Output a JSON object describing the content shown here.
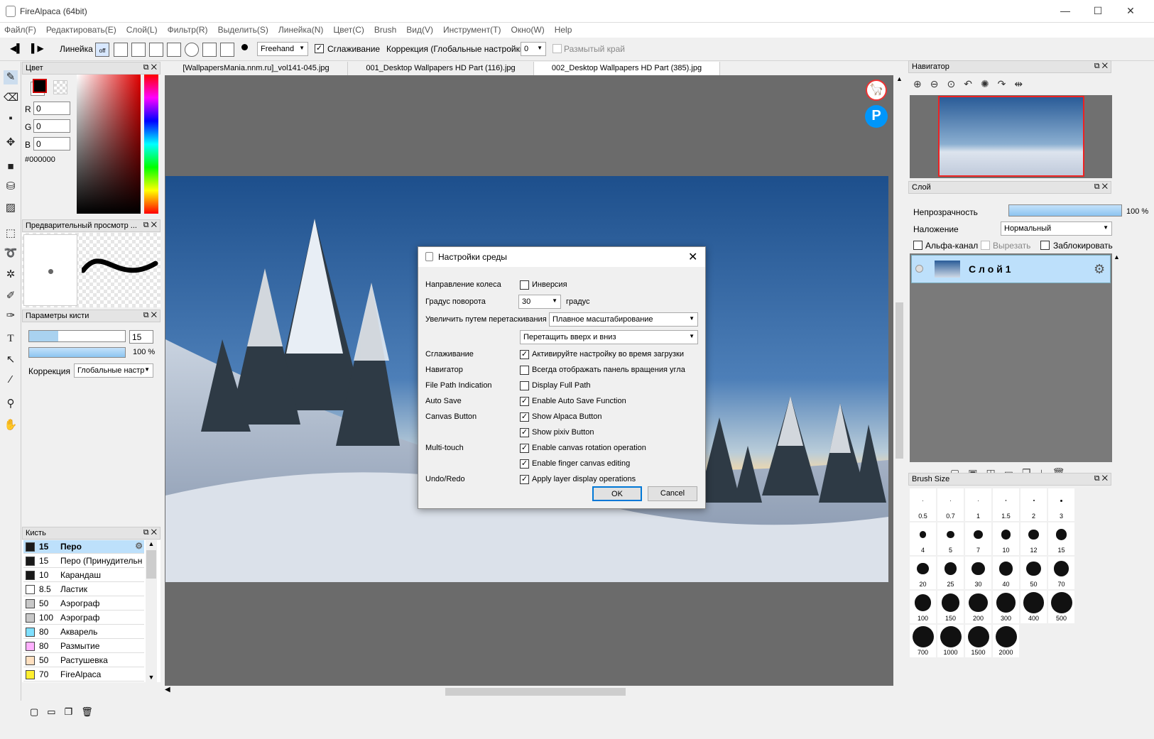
{
  "window": {
    "title": "FireAlpaca (64bit)"
  },
  "menu": [
    "Файл(F)",
    "Редактировать(E)",
    "Слой(L)",
    "Фильтр(R)",
    "Выделить(S)",
    "Линейка(N)",
    "Цвет(C)",
    "Brush",
    "Вид(V)",
    "Инструмент(T)",
    "Окно(W)",
    "Help"
  ],
  "toolbar": {
    "ruler_label": "Линейка",
    "off_label": "off",
    "mode": "Freehand",
    "smoothing_label": "Сглаживание",
    "correction_label": "Коррекция (Глобальные настройки)",
    "correction_value": "0",
    "blur_edge_label": "Размытый край"
  },
  "color_panel": {
    "title": "Цвет",
    "r_label": "R",
    "g_label": "G",
    "b_label": "B",
    "r": "0",
    "g": "0",
    "b": "0",
    "hex": "#000000",
    "fg": "#000000",
    "bg": "#ffffff"
  },
  "preview_panel": {
    "title": "Предварительный просмотр ..."
  },
  "brush_params": {
    "title": "Параметры кисти",
    "size": "15",
    "opacity": "100 %",
    "correction_label": "Коррекция",
    "correction_value": "Глобальные настр"
  },
  "brush_panel": {
    "title": "Кисть",
    "items": [
      {
        "size": "15",
        "name": "Перо",
        "color": "#1a1a1a"
      },
      {
        "size": "15",
        "name": "Перо (Принудительн",
        "color": "#1a1a1a"
      },
      {
        "size": "10",
        "name": "Карандаш",
        "color": "#1a1a1a"
      },
      {
        "size": "8.5",
        "name": "Ластик",
        "color": "#ffffff"
      },
      {
        "size": "50",
        "name": "Аэрограф",
        "color": "#c8c8c8"
      },
      {
        "size": "100",
        "name": "Аэрограф",
        "color": "#c8c8c8"
      },
      {
        "size": "80",
        "name": "Акварель",
        "color": "#7fe0ff"
      },
      {
        "size": "80",
        "name": "Размытие",
        "color": "#ffb0ff"
      },
      {
        "size": "50",
        "name": "Растушевка",
        "color": "#ffe0c0"
      },
      {
        "size": "70",
        "name": "FireAlpaca",
        "color": "#ffef30"
      }
    ]
  },
  "tabs": [
    "[WallpapersMania.nnm.ru]_vol141-045.jpg",
    "001_Desktop Wallpapers  HD Part (116).jpg",
    "002_Desktop Wallpapers  HD Part (385).jpg"
  ],
  "dialog": {
    "title": "Настройки среды",
    "rows": [
      {
        "label": "Направление колеса",
        "check": "Инверсия",
        "checked": false
      },
      {
        "label": "Градус поворота",
        "select": "30",
        "suffix": "градус"
      },
      {
        "label": "Увеличить путем перетаскивания",
        "select": "Плавное масштабирование"
      },
      {
        "label": "",
        "select": "Перетащить вверх и вниз"
      },
      {
        "label": "Сглаживание",
        "check": "Активируйте настройку во время загрузки",
        "checked": true
      },
      {
        "label": "Навигатор",
        "check": "Всегда отображать панель вращения угла",
        "checked": false
      },
      {
        "label": "File Path Indication",
        "check": "Display Full Path",
        "checked": false
      },
      {
        "label": "Auto Save",
        "check": "Enable Auto Save Function",
        "checked": true
      },
      {
        "label": "Canvas Button",
        "check": "Show Alpaca Button",
        "checked": true
      },
      {
        "label": "",
        "check": "Show pixiv Button",
        "checked": true
      },
      {
        "label": "Multi-touch",
        "check": "Enable canvas rotation operation",
        "checked": true
      },
      {
        "label": "",
        "check": "Enable finger canvas editing",
        "checked": true
      },
      {
        "label": "Undo/Redo",
        "check": "Apply layer display operations",
        "checked": true
      }
    ],
    "ok": "OK",
    "cancel": "Cancel"
  },
  "navigator": {
    "title": "Навигатор"
  },
  "layer_panel": {
    "title": "Слой",
    "opacity_label": "Непрозрачность",
    "opacity_value": "100 %",
    "opacity": 1.0,
    "blend_label": "Наложение",
    "blend_value": "Нормальный",
    "alpha_label": "Альфа-канал",
    "clip_label": "Вырезать",
    "lock_label": "Заблокировать",
    "layer_name": "С л о й 1"
  },
  "brush_size_panel": {
    "title": "Brush Size",
    "sizes": [
      "0.5",
      "0.7",
      "1",
      "1.5",
      "2",
      "3",
      "4",
      "5",
      "7",
      "10",
      "12",
      "15",
      "20",
      "25",
      "30",
      "40",
      "50",
      "70",
      "100",
      "150",
      "200",
      "300",
      "400",
      "500",
      "700",
      "1000",
      "1500",
      "2000"
    ]
  }
}
